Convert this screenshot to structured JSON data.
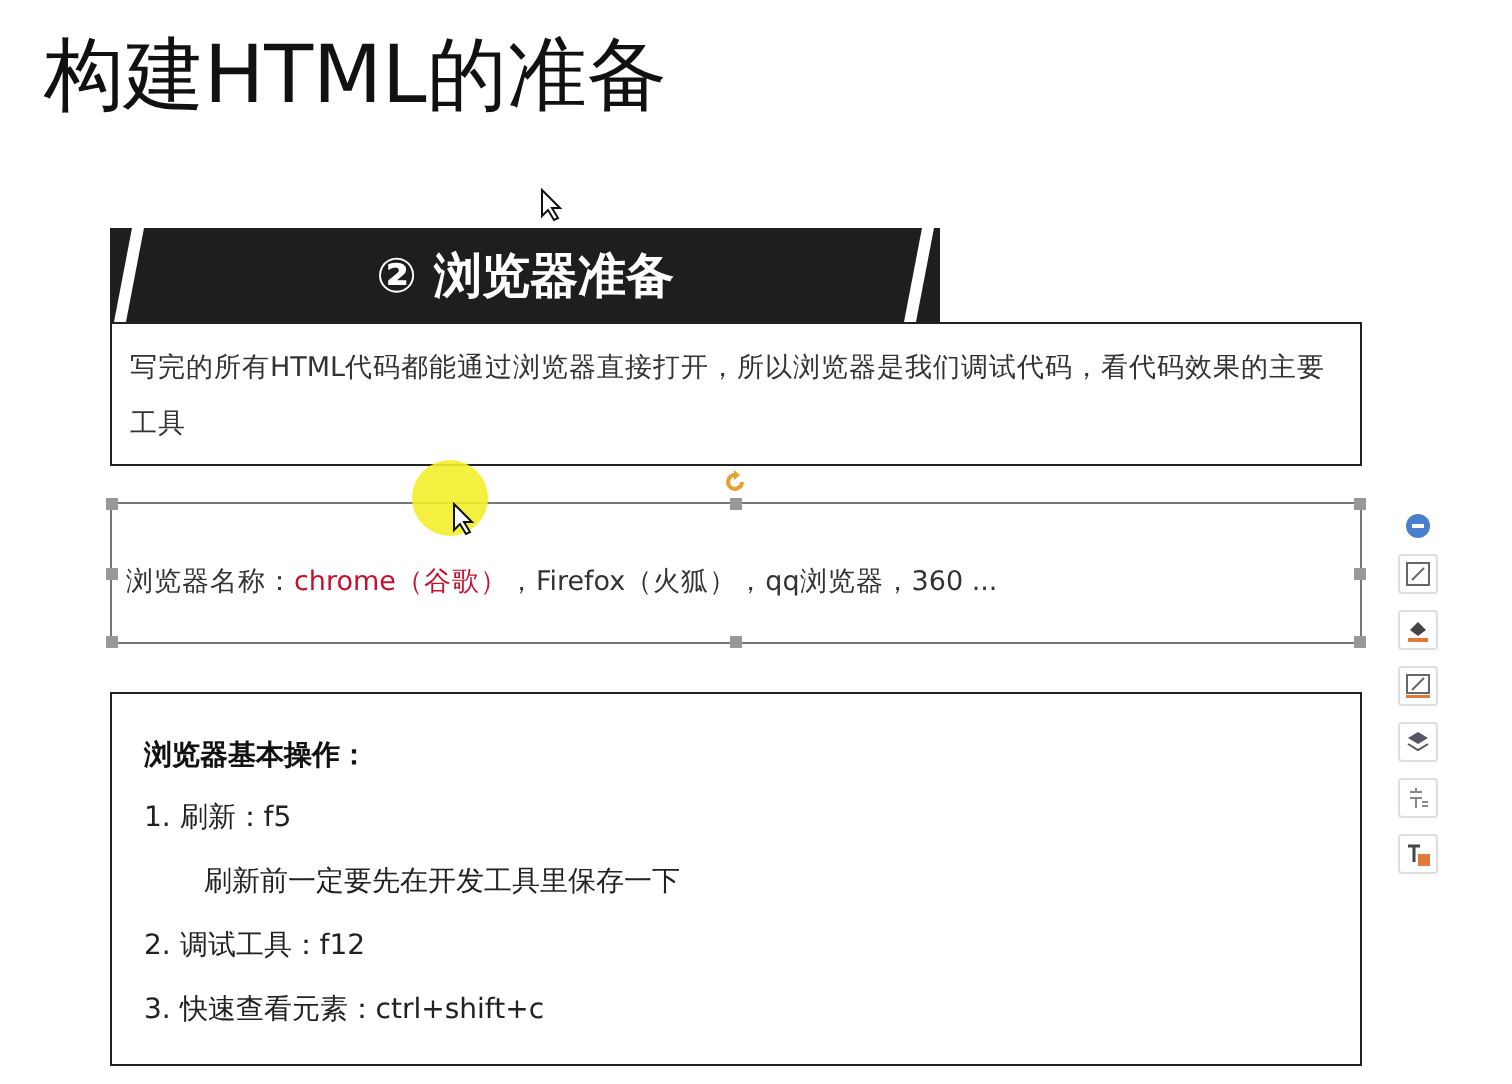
{
  "slide": {
    "title": "构建HTML的准备",
    "banner": {
      "text": "② 浏览器准备"
    },
    "intro": {
      "text": "写完的所有HTML代码都能通过浏览器直接打开，所以浏览器是我们调试代码，看代码效果的主要工具"
    },
    "browsers": {
      "selected": true,
      "parts": [
        {
          "text": "浏览器名称：",
          "highlight": false
        },
        {
          "text": "chrome（谷歌）",
          "highlight": true
        },
        {
          "text": "，Firefox（火狐），qq浏览器，360 ...",
          "highlight": false
        }
      ]
    },
    "operations": {
      "heading": "浏览器基本操作：",
      "lines": [
        {
          "kind": "item",
          "text": "1. 刷新：f5"
        },
        {
          "kind": "note",
          "text": "刷新前一定要先在开发工具里保存一下"
        },
        {
          "kind": "item",
          "text": "2. 调试工具：f12"
        },
        {
          "kind": "item",
          "text": "3. 快速查看元素：ctrl+shift+c"
        }
      ]
    }
  },
  "side_toolbar": {
    "tools": [
      {
        "kind": "collapse"
      },
      {
        "kind": "edit"
      },
      {
        "kind": "fill"
      },
      {
        "kind": "outline"
      },
      {
        "kind": "layers"
      },
      {
        "kind": "font"
      },
      {
        "kind": "textbox"
      }
    ]
  }
}
